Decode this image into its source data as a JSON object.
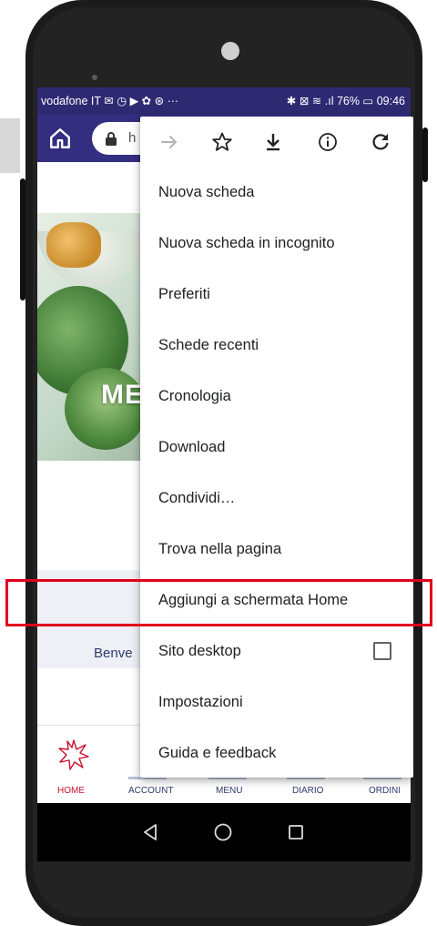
{
  "status_bar": {
    "left": "vodafone IT ✉ ◷ ▶ ✿ ⊛ ···",
    "right": "✱ ⊠ ≋ .ıl 76% ▭ 09:46"
  },
  "toolbar": {
    "url_text": "h"
  },
  "menu": {
    "items": [
      "Nuova scheda",
      "Nuova scheda in incognito",
      "Preferiti",
      "Schede recenti",
      "Cronologia",
      "Download",
      "Condividi…",
      "Trova nella pagina",
      "Aggiungi a schermata Home",
      "Sito desktop",
      "Impostazioni",
      "Guida e feedback"
    ]
  },
  "page": {
    "hero_title": "ME",
    "welcome_text": "Benve"
  },
  "bottom_nav": {
    "items": [
      "HOME",
      "ACCOUNT",
      "MENU",
      "DIARIO",
      "ORDINI"
    ]
  },
  "colors": {
    "status_bar": "#2e2a72",
    "toolbar": "#342e80",
    "highlight": "#e0001b",
    "nav_active": "#c8102e",
    "nav_text": "#2e3a6b"
  }
}
